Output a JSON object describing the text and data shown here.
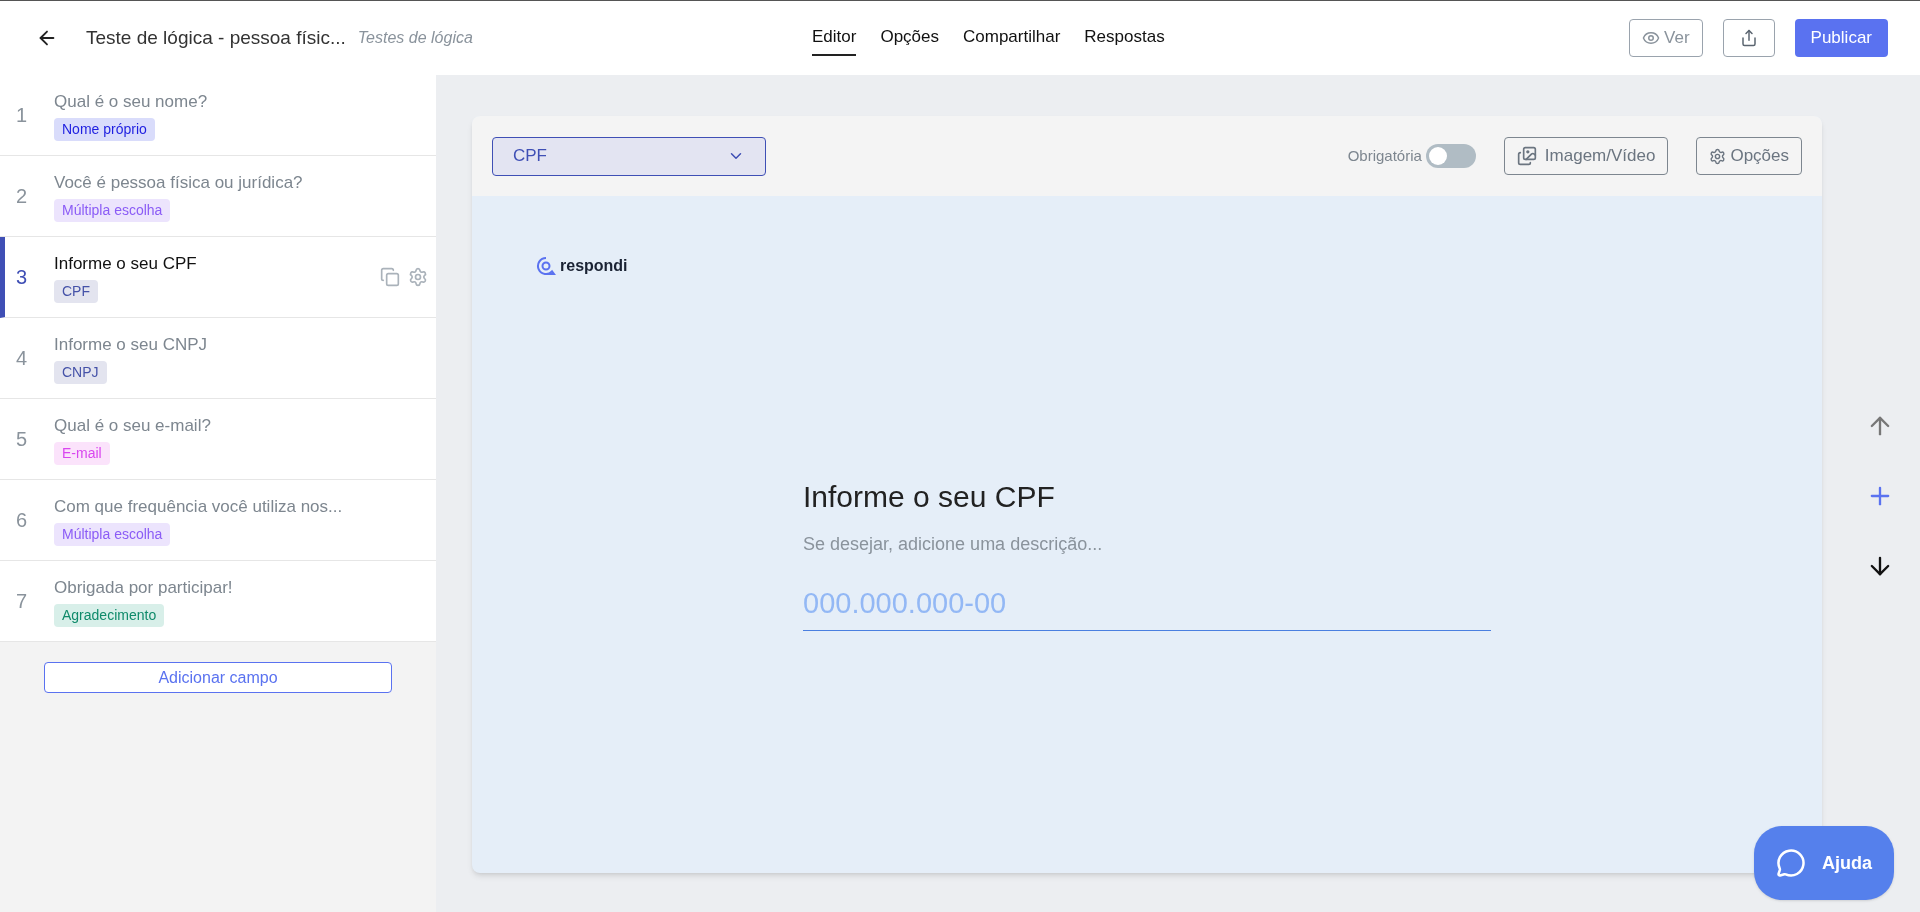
{
  "header": {
    "title": "Teste de lógica - pessoa físic...",
    "subtitle": "Testes de lógica",
    "tabs": [
      {
        "label": "Editor",
        "selected": true
      },
      {
        "label": "Opções",
        "selected": false
      },
      {
        "label": "Compartilhar",
        "selected": false
      },
      {
        "label": "Respostas",
        "selected": false
      }
    ],
    "view_button": "Ver",
    "publish_button": "Publicar"
  },
  "fields": [
    {
      "number": "1",
      "title": "Qual é o seu nome?",
      "tag": "Nome próprio",
      "kind": "name",
      "selected": false
    },
    {
      "number": "2",
      "title": "Você é pessoa física ou jurídica?",
      "tag": "Múltipla escolha",
      "kind": "choice",
      "selected": false
    },
    {
      "number": "3",
      "title": "Informe o seu CPF",
      "tag": "CPF",
      "kind": "document",
      "selected": true
    },
    {
      "number": "4",
      "title": "Informe o seu CNPJ",
      "tag": "CNPJ",
      "kind": "document",
      "selected": false
    },
    {
      "number": "5",
      "title": "Qual é o seu e-mail?",
      "tag": "E-mail",
      "kind": "email",
      "selected": false
    },
    {
      "number": "6",
      "title": "Com que frequência você utiliza nos...",
      "tag": "Múltipla escolha",
      "kind": "choice",
      "selected": false
    },
    {
      "number": "7",
      "title": "Obrigada por participar!",
      "tag": "Agradecimento",
      "kind": "thanks",
      "selected": false
    }
  ],
  "add_field_button": "Adicionar campo",
  "editor": {
    "type_select": "CPF",
    "required_label": "Obrigatória",
    "required": false,
    "media_button": "Imagem/Vídeo",
    "options_button": "Opções",
    "logo": "respondi",
    "question": "Informe o seu CPF",
    "description_placeholder": "Se desejar, adicione uma descrição...",
    "answer_placeholder": "000.000.000-00"
  },
  "help_button": "Ajuda"
}
